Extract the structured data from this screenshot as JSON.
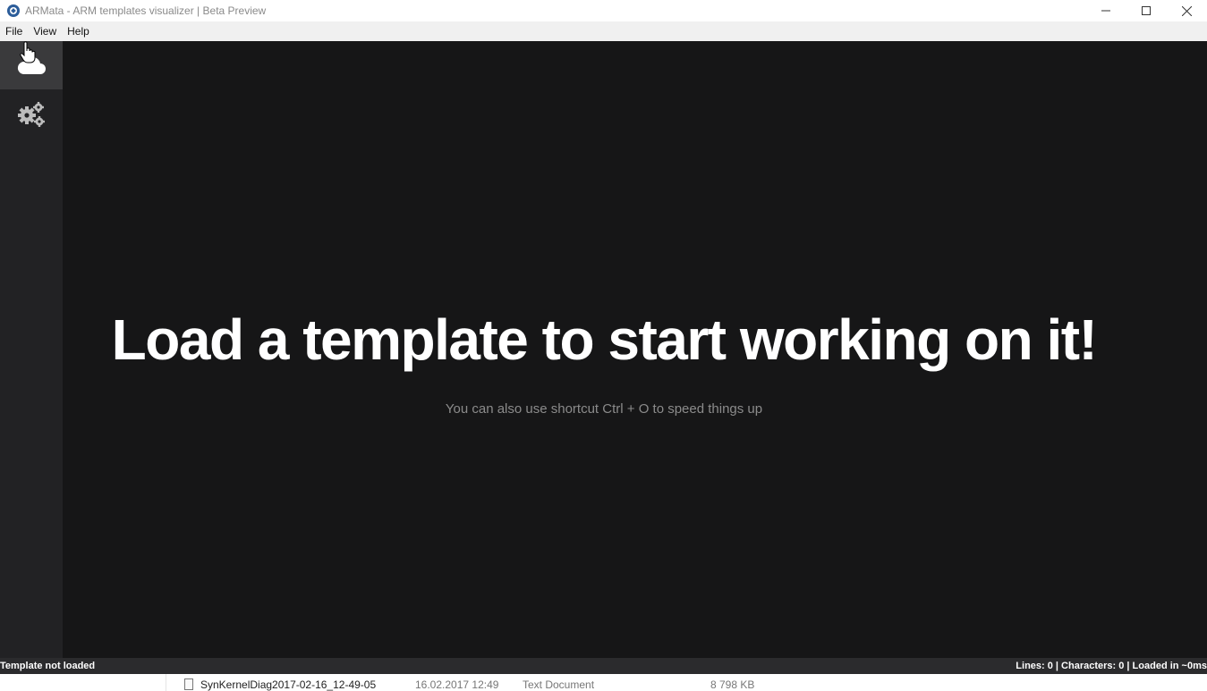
{
  "window": {
    "title": "ARMata - ARM templates visualizer | Beta Preview"
  },
  "menu": {
    "items": [
      "File",
      "View",
      "Help"
    ]
  },
  "sidebar": {
    "items": [
      {
        "icon": "cloud-icon",
        "active": true
      },
      {
        "icon": "gears-icon",
        "active": false
      }
    ]
  },
  "main": {
    "headline": "Load a template to start working on it!",
    "subline": "You can also use shortcut Ctrl + O to speed things up"
  },
  "status": {
    "left": "Template not loaded",
    "right": "Lines: 0 | Characters: 0 | Loaded in ~0ms"
  },
  "background_row": {
    "name": "SynKernelDiag2017-02-16_12-49-05",
    "date": "16.02.2017 12:49",
    "type": "Text Document",
    "size": "8 798 KB"
  },
  "colors": {
    "sidebar": "#222224",
    "main": "#161617",
    "statusbar": "#2b2b2d",
    "headline": "#ffffff",
    "subline": "#8b8b8b"
  }
}
